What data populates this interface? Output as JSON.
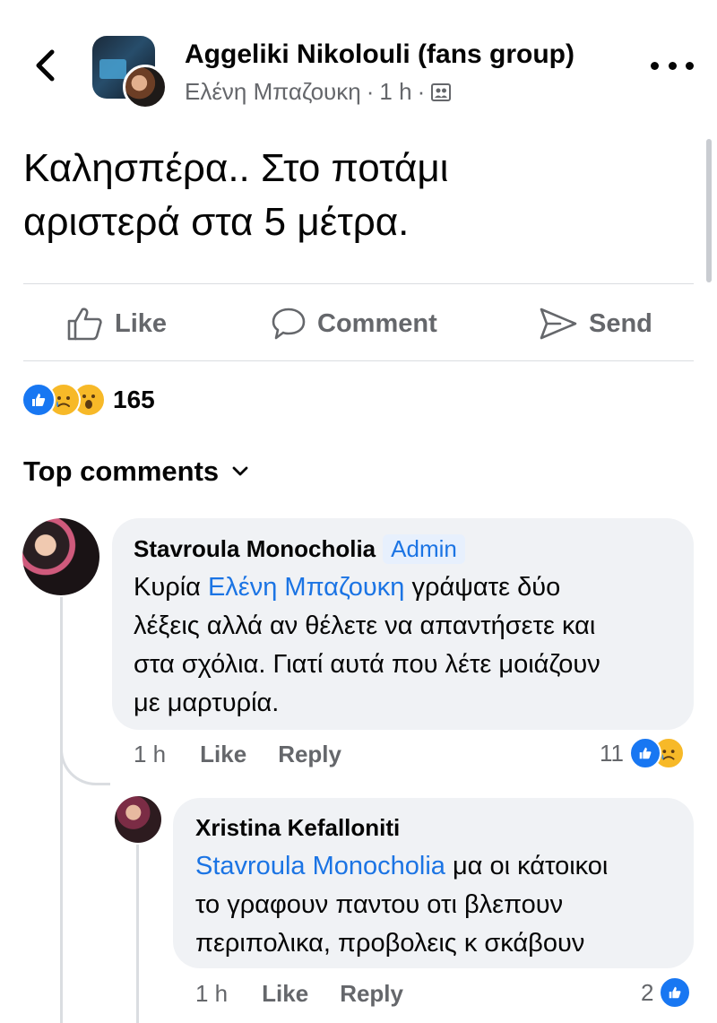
{
  "header": {
    "group_name": "Aggeliki Nikolouli (fans group)",
    "author": "Ελένη Μπαζουκη",
    "time": "1 h",
    "separator": "·"
  },
  "post": {
    "text_line1": "Καλησπέρα.. Στο ποτάμι",
    "text_line2": "αριστερά στα 5 μέτρα."
  },
  "actions": {
    "like": "Like",
    "comment": "Comment",
    "send": "Send"
  },
  "reactions": {
    "count": "165",
    "types": [
      "like-icon",
      "sad-icon",
      "wow-icon"
    ]
  },
  "comments_header": "Top comments",
  "comments": [
    {
      "author": "Stavroula Monocholia",
      "badge": "Admin",
      "text_pre": "Κυρία ",
      "mention": "Ελένη Μπαζουκη",
      "text_line1_post": " γράψατε δύο",
      "text_line2": "λέξεις αλλά αν θέλετε να απαντήσετε και",
      "text_line3": "στα σχόλια. Γιατί αυτά που λέτε μοιάζουν",
      "text_line4": "με μαρτυρία.",
      "time": "1 h",
      "like": "Like",
      "reply": "Reply",
      "reaction_count": "11"
    },
    {
      "author": "Xristina Kefalloniti",
      "mention": "Stavroula Monocholia",
      "text_line1_post": " μα οι κάτοικοι",
      "text_line2": "το γραφουν παντου οτι βλεπουν",
      "text_line3": "περιπολικα, προβολεις κ σκάβουν",
      "time": "1 h",
      "like": "Like",
      "reply": "Reply",
      "reaction_count": "2"
    }
  ],
  "colors": {
    "accent": "#1877f2",
    "mention": "#1b74e4",
    "secondary_text": "#65676b",
    "bubble": "#f0f2f5",
    "divider": "#dadde1"
  }
}
